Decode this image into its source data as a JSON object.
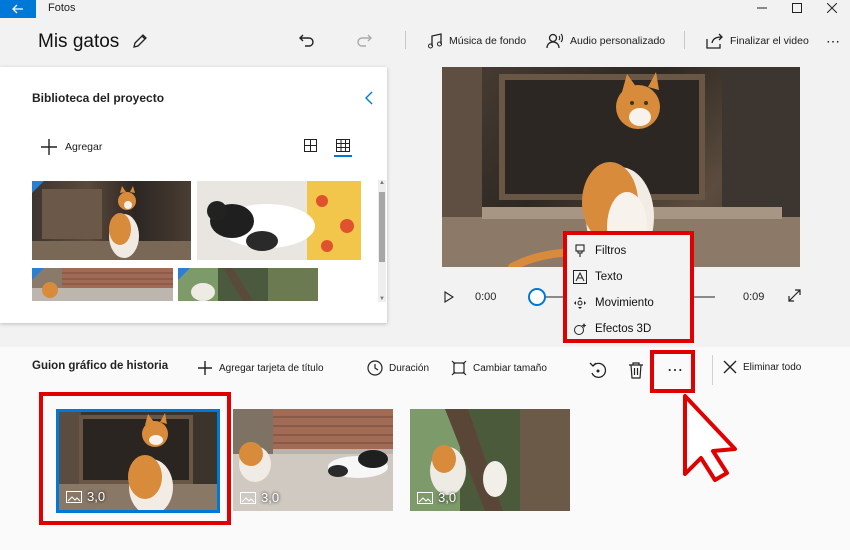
{
  "app": {
    "title": "Fotos"
  },
  "project": {
    "title": "Mis gatos"
  },
  "toolbar": {
    "music_label": "Música de fondo",
    "audio_label": "Audio personalizado",
    "finish_label": "Finalizar el video"
  },
  "library": {
    "title": "Biblioteca del proyecto",
    "add_label": "Agregar"
  },
  "player": {
    "current_time": "0:00",
    "total_time": "0:09",
    "progress": 0
  },
  "context_menu": {
    "items": [
      {
        "label": "Filtros",
        "icon": "paint-brush-icon"
      },
      {
        "label": "Texto",
        "icon": "text-icon"
      },
      {
        "label": "Movimiento",
        "icon": "motion-icon"
      },
      {
        "label": "Efectos 3D",
        "icon": "effects-3d-icon"
      }
    ]
  },
  "storyboard": {
    "title": "Guion gráfico de historia",
    "add_title_card": "Agregar tarjeta de título",
    "duration": "Duración",
    "resize": "Cambiar tamaño",
    "remove_all": "Eliminar todo",
    "cards": [
      {
        "duration": "3,0",
        "selected": true
      },
      {
        "duration": "3,0",
        "selected": false
      },
      {
        "duration": "3,0",
        "selected": false
      }
    ]
  },
  "colors": {
    "accent": "#0078d7",
    "highlight": "#e00000"
  }
}
